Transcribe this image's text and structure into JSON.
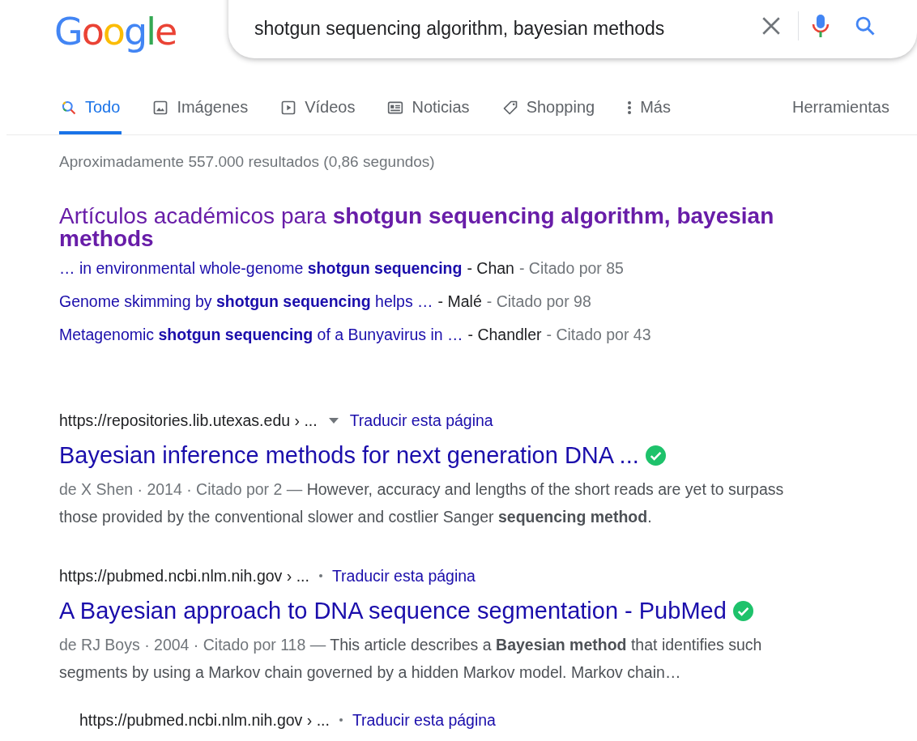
{
  "logo": "Google",
  "search": {
    "value": "shotgun sequencing algorithm, bayesian methods"
  },
  "tabs": [
    {
      "label": "Todo",
      "kind": "all",
      "selected": true
    },
    {
      "label": "Imágenes",
      "kind": "images",
      "selected": false
    },
    {
      "label": "Vídeos",
      "kind": "videos",
      "selected": false
    },
    {
      "label": "Noticias",
      "kind": "news",
      "selected": false
    },
    {
      "label": "Shopping",
      "kind": "shopping",
      "selected": false
    },
    {
      "label": "Más",
      "kind": "more",
      "selected": false
    }
  ],
  "tools": "Herramientas",
  "result_stats": "Aproximadamente 557.000 resultados (0,86 segundos)",
  "scholar": {
    "heading": "Artículos académicos para **shotgun sequencing algorithm, bayesian methods**",
    "items": [
      {
        "title": "… in environmental whole-genome **shotgun sequencing**",
        "author": "- Chan",
        "cited": "- Citado por 85"
      },
      {
        "title": "Genome skimming by **shotgun sequencing** helps …",
        "author": "- Malé",
        "cited": "- Citado por 98"
      },
      {
        "title": "Metagenomic **shotgun sequencing** of a Bunyavirus in …",
        "author": "- Chandler",
        "cited": "- Citado por 43"
      }
    ]
  },
  "results": [
    {
      "kind": "main",
      "url": "https://repositories.lib.utexas.edu › ...",
      "menu": true,
      "translate": "Traducir esta página",
      "title": "Bayesian inference methods for next generation DNA ...",
      "verified": true,
      "meta": "de X Shen · 2014 · Citado por 2 — ",
      "snippet": "However, accuracy and lengths of the short reads are yet to surpass those provided by the conventional slower and costlier Sanger **sequencing method**."
    },
    {
      "kind": "main",
      "url": "https://pubmed.ncbi.nlm.nih.gov › ...",
      "menu": false,
      "translate": "Traducir esta página",
      "title": "A Bayesian approach to DNA sequence segmentation - PubMed",
      "verified": true,
      "meta": "de RJ Boys · 2004 · Citado por 118 — ",
      "snippet": "This article describes a **Bayesian method** that identifies such segments by using a Markov chain governed by a hidden Markov model. Markov chain…"
    },
    {
      "kind": "sub",
      "url": "https://pubmed.ncbi.nlm.nih.gov › ...",
      "menu": false,
      "translate": "Traducir esta página"
    }
  ]
}
